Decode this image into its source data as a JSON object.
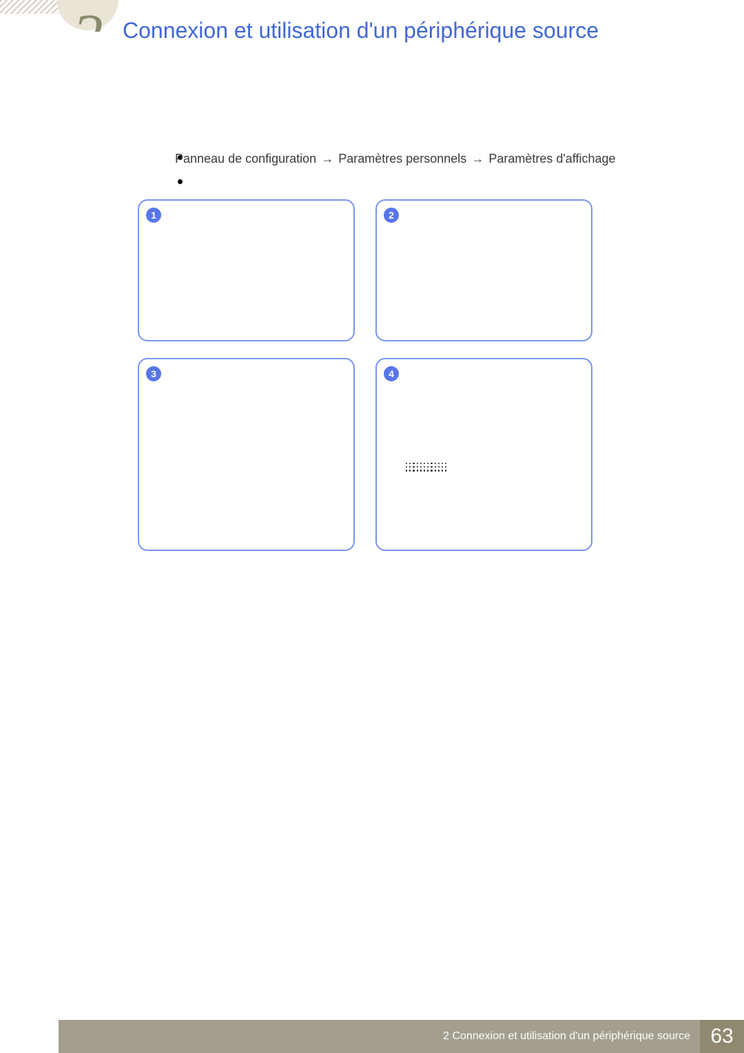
{
  "chapter": {
    "number": "2",
    "title": "Connexion et utilisation d'un périphérique source"
  },
  "nav": {
    "path_parts": [
      "Panneau de configuration",
      "Paramètres personnels",
      "Paramètres d'affichage"
    ],
    "arrow": "→"
  },
  "panels": {
    "numbers": [
      "1",
      "2",
      "3",
      "4"
    ]
  },
  "footer": {
    "text": "2 Connexion et utilisation d'un périphérique source",
    "page_number": "63"
  }
}
